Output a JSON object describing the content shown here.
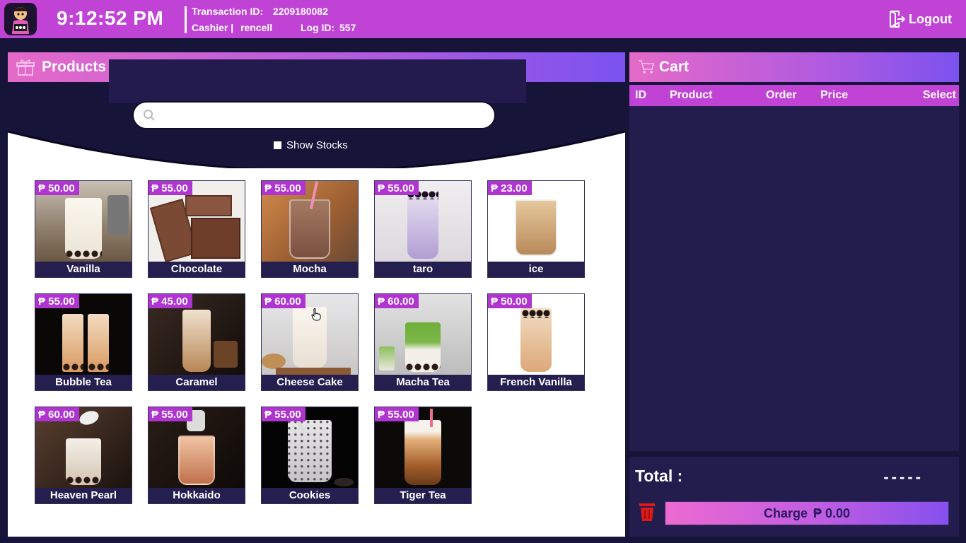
{
  "header": {
    "time": "9:12:52 PM",
    "transaction_label": "Transaction ID:",
    "transaction_id": "2209180082",
    "cashier_label": "Cashier |",
    "cashier_name": "rencell",
    "log_label": "Log ID:",
    "log_id": "557",
    "logout_label": "Logout"
  },
  "products_panel": {
    "title": "Products",
    "search_placeholder": "",
    "show_stocks_label": "Show Stocks",
    "show_stocks_checked": false,
    "items": [
      {
        "price": "₱ 50.00",
        "name": "Vanilla",
        "icon": "vanilla-milk-tea-image"
      },
      {
        "price": "₱ 55.00",
        "name": "Chocolate",
        "icon": "chocolate-image"
      },
      {
        "price": "₱ 55.00",
        "name": "Mocha",
        "icon": "mocha-drink-image"
      },
      {
        "price": "₱ 55.00",
        "name": "taro",
        "icon": "taro-milk-tea-image"
      },
      {
        "price": "₱ 23.00",
        "name": "ice",
        "icon": "iced-coffee-image"
      },
      {
        "price": "₱ 55.00",
        "name": "Bubble Tea",
        "icon": "bubble-tea-image"
      },
      {
        "price": "₱ 45.00",
        "name": "Caramel",
        "icon": "caramel-milk-tea-image"
      },
      {
        "price": "₱ 60.00",
        "name": "Cheese Cake",
        "icon": "cheese-cake-drink-image"
      },
      {
        "price": "₱ 60.00",
        "name": "Macha Tea",
        "icon": "matcha-tea-image"
      },
      {
        "price": "₱ 50.00",
        "name": "French Vanilla",
        "icon": "french-vanilla-image"
      },
      {
        "price": "₱ 60.00",
        "name": "Heaven Pearl",
        "icon": "heaven-pearl-image"
      },
      {
        "price": "₱ 55.00",
        "name": "Hokkaido",
        "icon": "hokkaido-milk-tea-image"
      },
      {
        "price": "₱ 55.00",
        "name": "Cookies",
        "icon": "cookies-and-cream-image"
      },
      {
        "price": "₱ 55.00",
        "name": "Tiger Tea",
        "icon": "tiger-tea-image"
      }
    ]
  },
  "cart": {
    "title": "Cart",
    "columns": [
      "ID",
      "Product",
      "Order",
      "Price",
      "Select"
    ],
    "rows": [],
    "total_label": "Total :",
    "total_value": "-----",
    "charge_label": "Charge",
    "charge_amount": "₱ 0.00"
  },
  "colors": {
    "topbar": "#c143d6",
    "background": "#17143a",
    "panel_dark": "#231d4d",
    "price_badge": "#b034d0",
    "name_bar": "#241f4f",
    "header_gradient_start": "#e56ac8",
    "header_gradient_end": "#7b52ef",
    "trash_red": "#e01818"
  }
}
